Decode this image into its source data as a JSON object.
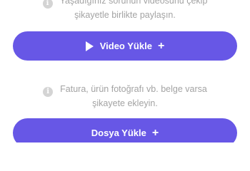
{
  "hints": {
    "video": {
      "icon": "info-icon",
      "line1": "Yaşadığınız sorunun videosunu çekip",
      "line2": "şikayetle birlikte paylaşın."
    },
    "document": {
      "icon": "info-icon",
      "line1": "Fatura, ürün fotoğrafı vb. belge varsa",
      "line2": "şikayete ekleyin."
    }
  },
  "buttons": {
    "video_upload": {
      "label": "Video Yükle",
      "icon": "play-icon",
      "trailing": "+"
    },
    "file_upload": {
      "label": "Dosya Yükle",
      "trailing": "+"
    }
  },
  "colors": {
    "primary": "#6757e6",
    "hint_text": "#a3a3a3",
    "info_icon": "#d4d4d4"
  }
}
